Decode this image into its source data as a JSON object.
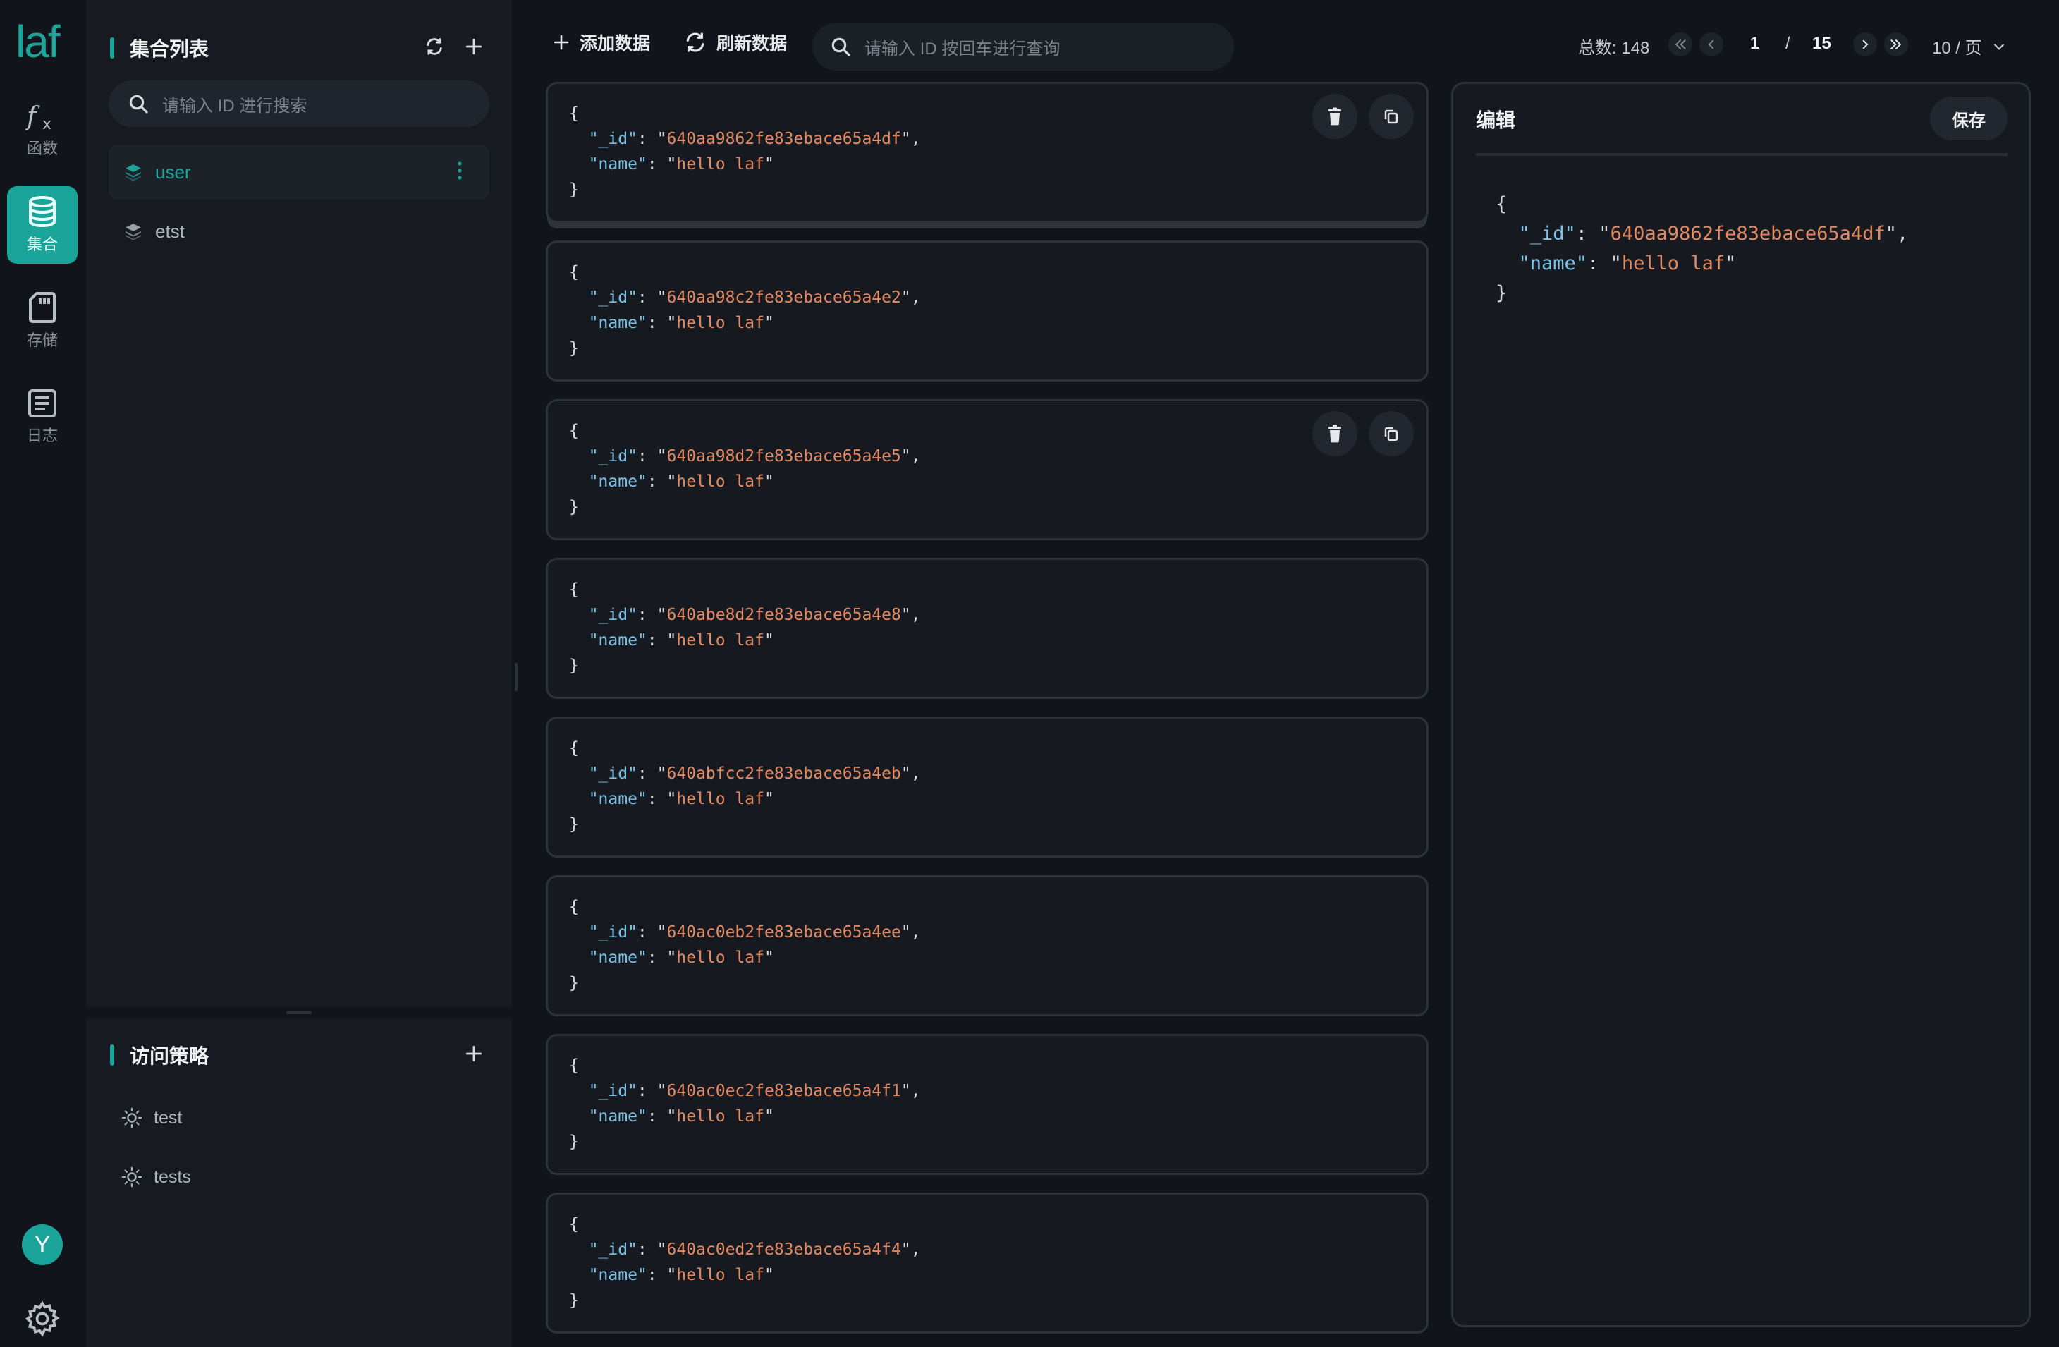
{
  "app": {
    "logo": "laf"
  },
  "nav": [
    {
      "label": "函数",
      "icon": "function-icon"
    },
    {
      "label": "集合",
      "icon": "database-icon"
    },
    {
      "label": "存储",
      "icon": "storage-icon"
    },
    {
      "label": "日志",
      "icon": "log-icon"
    }
  ],
  "user": {
    "avatar_text": "Y"
  },
  "collections": {
    "title": "集合列表",
    "search_placeholder": "请输入 ID 进行搜索",
    "items": [
      {
        "name": "user",
        "active": true
      },
      {
        "name": "etst",
        "active": false
      }
    ]
  },
  "policies": {
    "title": "访问策略",
    "items": [
      {
        "name": "test"
      },
      {
        "name": "tests"
      }
    ]
  },
  "toolbar": {
    "add_label": "添加数据",
    "refresh_label": "刷新数据",
    "search_placeholder": "请输入 ID 按回车进行查询"
  },
  "pagination": {
    "total_label": "总数: 148",
    "current_page": "1",
    "separator": "/",
    "total_pages": "15",
    "page_size": "10 / 页"
  },
  "documents": [
    {
      "id": "640aa9862fe83ebace65a4df",
      "name": "hello laf",
      "show_actions": true
    },
    {
      "id": "640aa98c2fe83ebace65a4e2",
      "name": "hello laf",
      "show_actions": false
    },
    {
      "id": "640aa98d2fe83ebace65a4e5",
      "name": "hello laf",
      "show_actions": true
    },
    {
      "id": "640abe8d2fe83ebace65a4e8",
      "name": "hello laf",
      "show_actions": false
    },
    {
      "id": "640abfcc2fe83ebace65a4eb",
      "name": "hello laf",
      "show_actions": false
    },
    {
      "id": "640ac0eb2fe83ebace65a4ee",
      "name": "hello laf",
      "show_actions": false
    },
    {
      "id": "640ac0ec2fe83ebace65a4f1",
      "name": "hello laf",
      "show_actions": false
    },
    {
      "id": "640ac0ed2fe83ebace65a4f4",
      "name": "hello laf",
      "show_actions": false
    }
  ],
  "editor": {
    "title": "编辑",
    "save_label": "保存",
    "doc": {
      "id": "640aa9862fe83ebace65a4df",
      "name": "hello laf"
    }
  },
  "json_syntax": {
    "open": "{",
    "close": "}",
    "id_key": "\"_id\"",
    "name_key": "\"name\""
  },
  "colors": {
    "accent": "#1aa49a",
    "json_key": "#7cc3e6",
    "json_string": "#e48a63",
    "background": "#11141a"
  }
}
